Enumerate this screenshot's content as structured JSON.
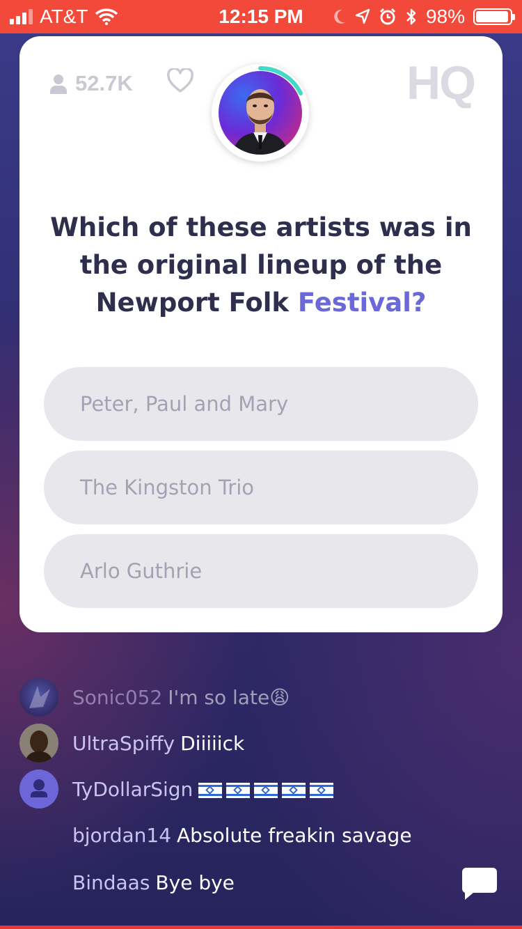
{
  "status_bar": {
    "carrier": "AT&T",
    "time": "12:15 PM",
    "battery": "98%",
    "background": "#f2493a"
  },
  "card": {
    "viewer_count": "52.7K",
    "logo": "HQ",
    "question_main": "Which of these artists was in the original lineup of the Newport Folk",
    "question_accent": "Festival?",
    "answers": [
      "Peter, Paul and Mary",
      "The Kingston Trio",
      "Arlo Guthrie"
    ],
    "accent_color": "#6b68d8"
  },
  "chat": [
    {
      "user": "Sonic052",
      "message": "I'm so late😩"
    },
    {
      "user": "UltraSpiffy",
      "message": "Diiiiick"
    },
    {
      "user": "TyDollarSign",
      "message": ""
    },
    {
      "user": "bjordan14",
      "message": "Absolute freakin savage"
    },
    {
      "user": "Bindaas",
      "message": "Bye bye"
    }
  ]
}
